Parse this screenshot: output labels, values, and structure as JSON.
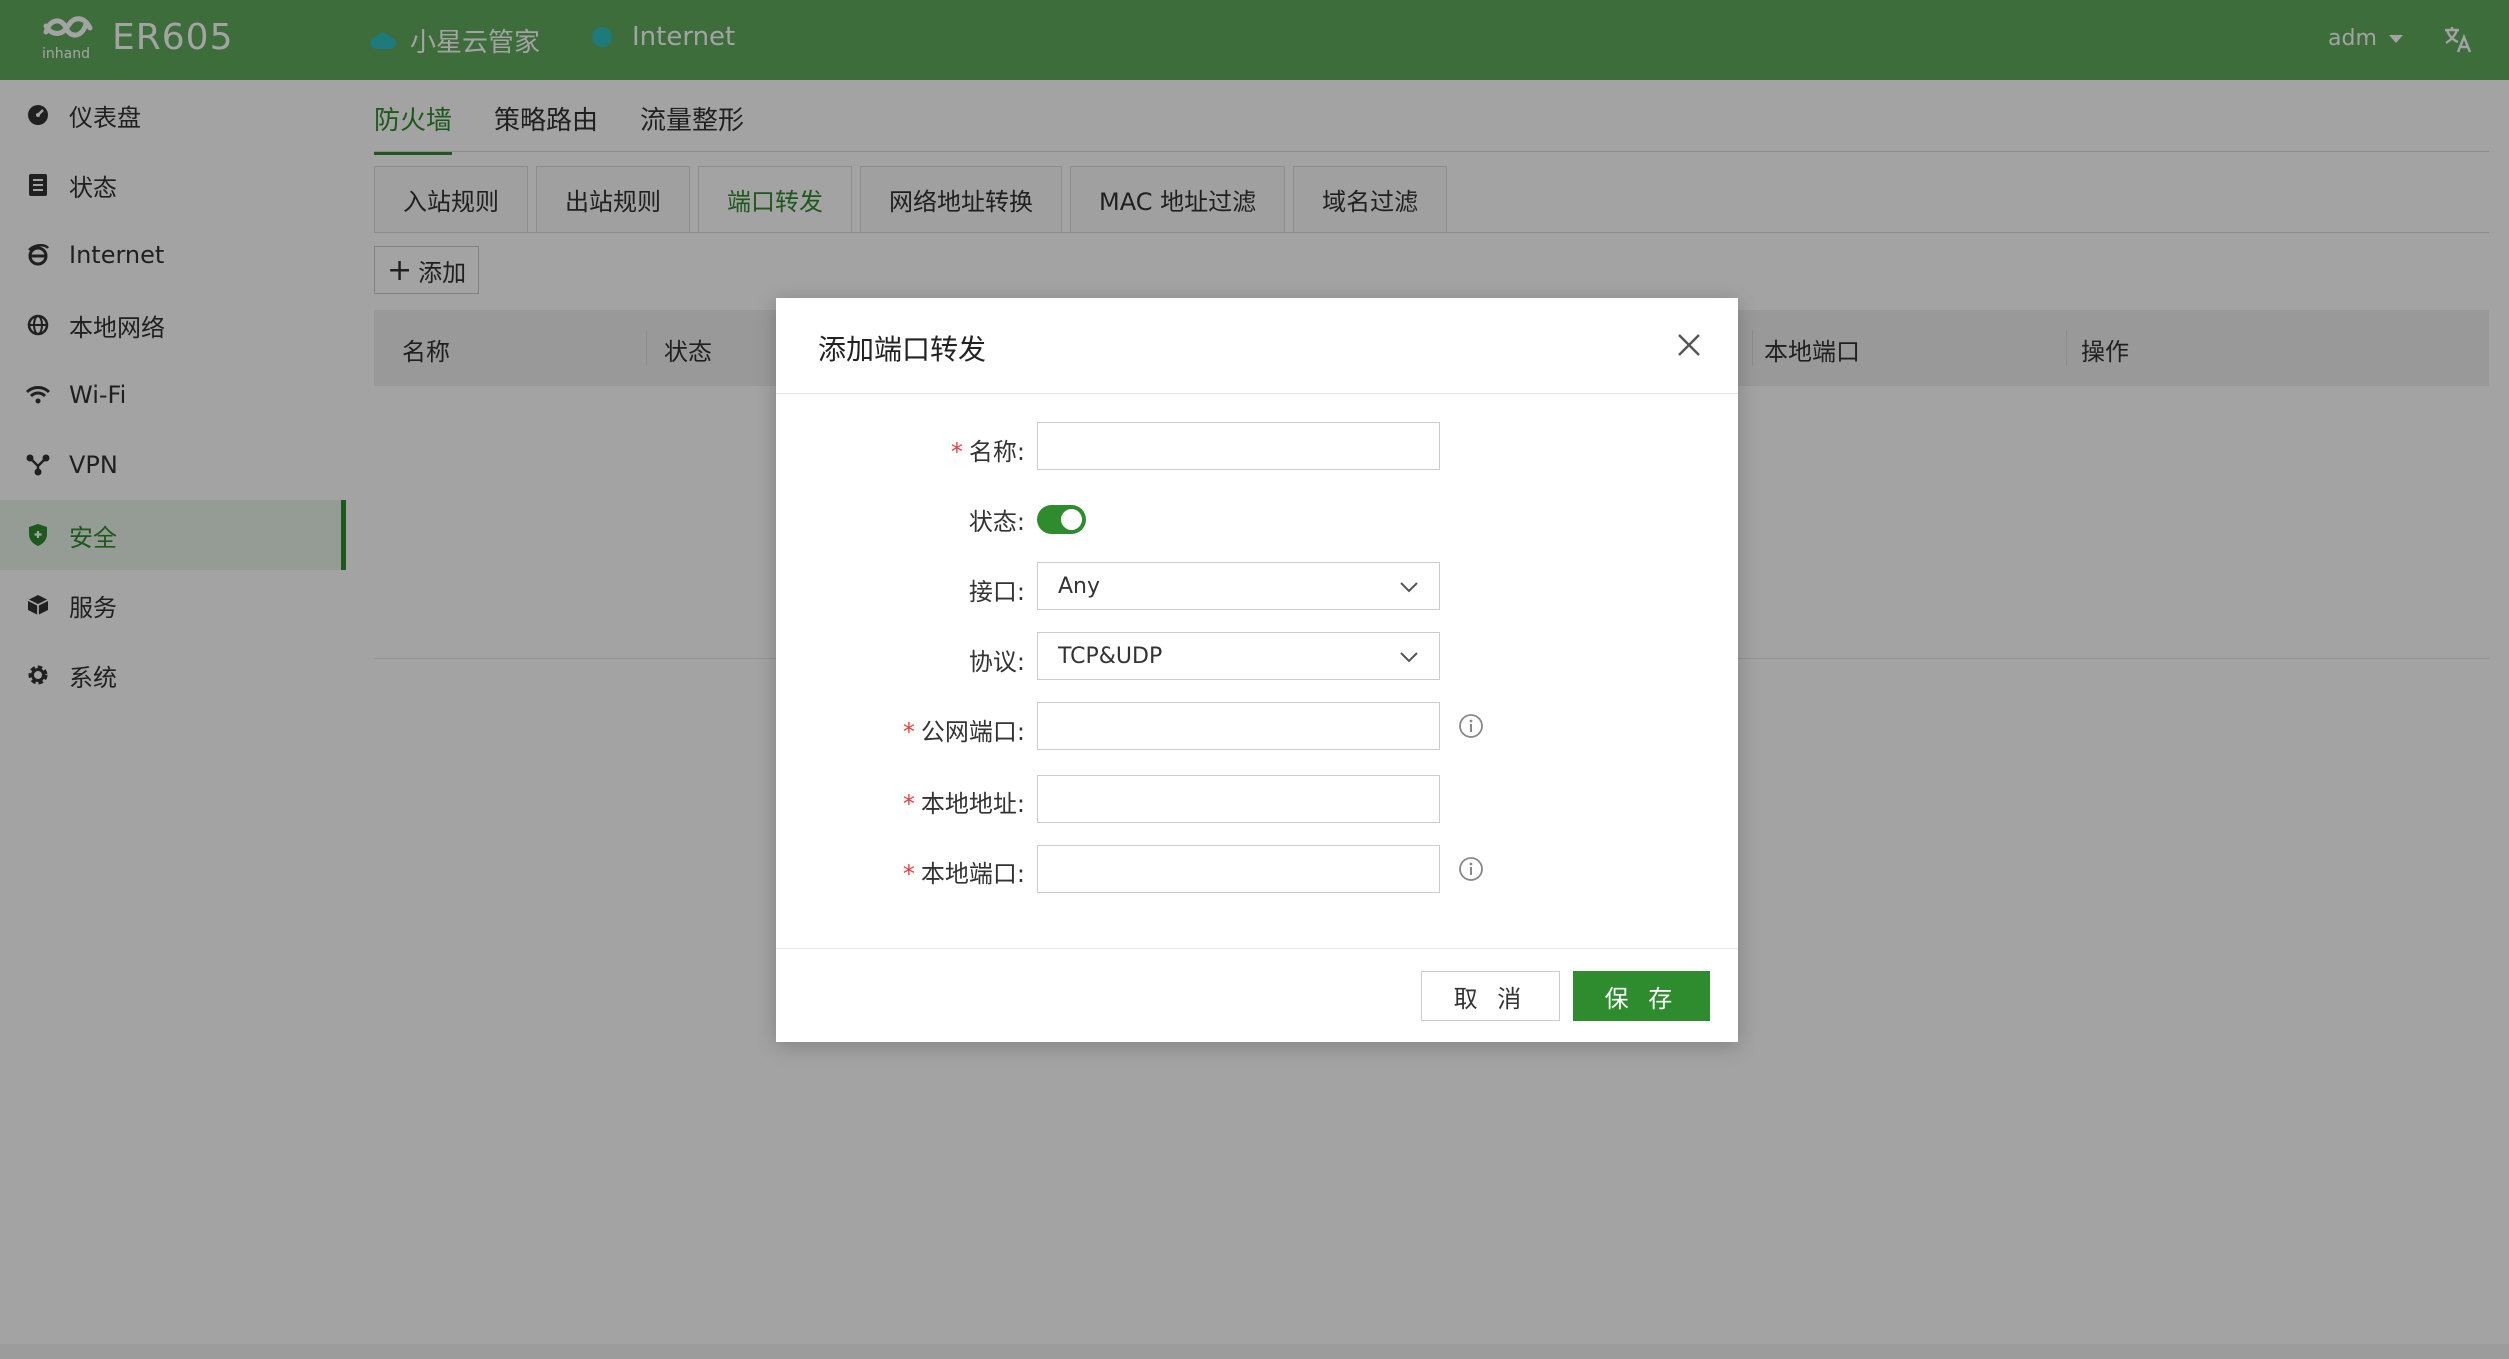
{
  "header": {
    "brand": "ER605",
    "logo_text": "inhand",
    "cloud_label": "小星云管家",
    "internet_label": "Internet",
    "user": "adm"
  },
  "sidebar": {
    "items": [
      {
        "label": "仪表盘",
        "icon": "dashboard-icon"
      },
      {
        "label": "状态",
        "icon": "status-icon"
      },
      {
        "label": "Internet",
        "icon": "internet-icon"
      },
      {
        "label": "本地网络",
        "icon": "globe-icon"
      },
      {
        "label": "Wi-Fi",
        "icon": "wifi-icon"
      },
      {
        "label": "VPN",
        "icon": "vpn-icon"
      },
      {
        "label": "安全",
        "icon": "shield-icon",
        "active": true
      },
      {
        "label": "服务",
        "icon": "cube-icon"
      },
      {
        "label": "系统",
        "icon": "gear-icon"
      }
    ]
  },
  "main": {
    "top_tabs": [
      "防火墙",
      "策略路由",
      "流量整形"
    ],
    "sub_tabs": [
      "入站规则",
      "出站规则",
      "端口转发",
      "网络地址转换",
      "MAC 地址过滤",
      "域名过滤"
    ],
    "add_label": "添加",
    "table_headers": {
      "name": "名称",
      "status": "状态",
      "local_port": "本地端口",
      "actions": "操作"
    }
  },
  "modal": {
    "title": "添加端口转发",
    "fields": {
      "name": "名称:",
      "status": "状态:",
      "interface": "接口:",
      "protocol": "协议:",
      "public_port": "公网端口:",
      "local_address": "本地地址:",
      "local_port": "本地端口:"
    },
    "values": {
      "interface": "Any",
      "protocol": "TCP&UDP",
      "status_on": true
    },
    "cancel": "取 消",
    "save": "保 存"
  },
  "colors": {
    "header": "#5eab5d",
    "accent": "#2e8b2e",
    "required": "#e0403c",
    "internet_dot": "#2fc1c0"
  }
}
